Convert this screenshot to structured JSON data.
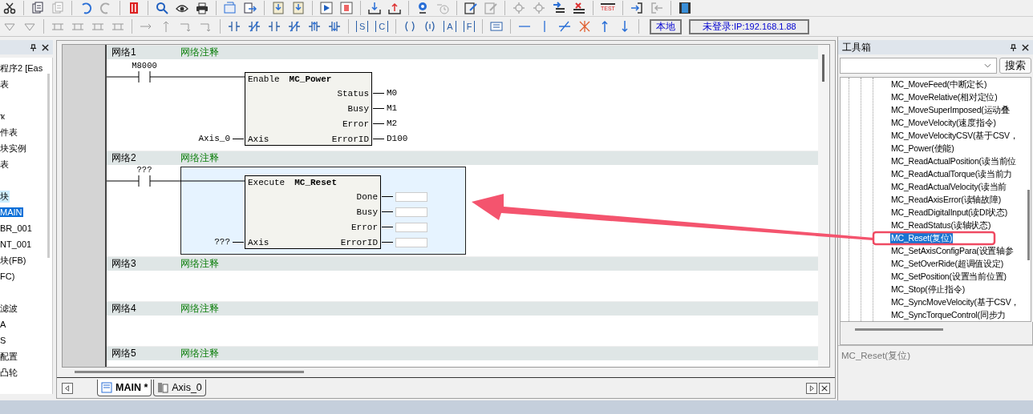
{
  "toolbar": {
    "test_label": "TEST",
    "instruction_letters": [
      "S",
      "C",
      "A",
      "F"
    ],
    "mode_button": "本地",
    "login_status": {
      "label": "未登录",
      "detail": ":IP:192.168.1.88"
    }
  },
  "project_panel": {
    "items": [
      {
        "label": "程序2 [Eas",
        "selected": false,
        "highlighted": false
      },
      {
        "label": "表",
        "selected": false,
        "highlighted": false,
        "gap_after": true
      },
      {
        "label": "ҡ",
        "selected": false,
        "highlighted": false
      },
      {
        "label": "件表",
        "selected": false,
        "highlighted": false
      },
      {
        "label": "块实例",
        "selected": false,
        "highlighted": false
      },
      {
        "label": "表",
        "selected": false,
        "highlighted": false,
        "gap_after": true
      },
      {
        "label": "块",
        "selected": false,
        "highlighted": true
      },
      {
        "label": "MAIN",
        "selected": true
      },
      {
        "label": "BR_001",
        "selected": false,
        "highlighted": false
      },
      {
        "label": "NT_001",
        "selected": false,
        "highlighted": false
      },
      {
        "label": "块(FB)",
        "selected": false,
        "highlighted": false
      },
      {
        "label": "FC)",
        "selected": false,
        "highlighted": false,
        "gap_after": true
      },
      {
        "label": "滤波",
        "selected": false,
        "highlighted": false
      },
      {
        "label": "A",
        "selected": false,
        "highlighted": false
      },
      {
        "label": "S",
        "selected": false,
        "highlighted": false
      },
      {
        "label": "配置",
        "selected": false,
        "highlighted": false
      },
      {
        "label": "凸轮",
        "selected": false,
        "highlighted": false
      }
    ]
  },
  "editor": {
    "networks": [
      {
        "label": "网络1",
        "comment": "网络注释",
        "selected": false,
        "contact": "M8000",
        "block": {
          "name": "MC_Power",
          "enable_pin": "Enable",
          "inputs": [
            {
              "pin": "Axis",
              "value": "Axis_0"
            }
          ],
          "outputs": [
            {
              "pin": "Status",
              "value": "M0"
            },
            {
              "pin": "Busy",
              "value": "M1"
            },
            {
              "pin": "Error",
              "value": "M2"
            },
            {
              "pin": "ErrorID",
              "value": "D100"
            }
          ]
        }
      },
      {
        "label": "网络2",
        "comment": "网络注释",
        "selected": true,
        "contact": "???",
        "block": {
          "name": "MC_Reset",
          "enable_pin": "Execute",
          "inputs": [
            {
              "pin": "Axis",
              "value": "???"
            }
          ],
          "outputs": [
            {
              "pin": "Done"
            },
            {
              "pin": "Busy"
            },
            {
              "pin": "Error"
            },
            {
              "pin": "ErrorID"
            }
          ]
        }
      },
      {
        "label": "网络3",
        "comment": "网络注释",
        "selected": false
      },
      {
        "label": "网络4",
        "comment": "网络注释",
        "selected": false
      },
      {
        "label": "网络5",
        "comment": "网络注释",
        "selected": false
      }
    ],
    "tabs": [
      {
        "label": "MAIN *",
        "kind": "program",
        "selected": true
      },
      {
        "label": "Axis_0",
        "kind": "axis",
        "selected": false
      }
    ]
  },
  "toolbox": {
    "title": "工具箱",
    "search_button": "搜索",
    "items": [
      {
        "label": "MC_MoveFeed(中断定长)",
        "selected": false
      },
      {
        "label": "MC_MoveRelative(相对定位)",
        "selected": false
      },
      {
        "label": "MC_MoveSuperImposed(运动叠",
        "selected": false
      },
      {
        "label": "MC_MoveVelocity(速度指令)",
        "selected": false
      },
      {
        "label": "MC_MoveVelocityCSV(基于CSV，",
        "selected": false
      },
      {
        "label": "MC_Power(使能)",
        "selected": false
      },
      {
        "label": "MC_ReadActualPosition(读当前位",
        "selected": false
      },
      {
        "label": "MC_ReadActualTorque(读当前力",
        "selected": false
      },
      {
        "label": "MC_ReadActualVelocity(读当前",
        "selected": false
      },
      {
        "label": "MC_ReadAxisError(读轴故障)",
        "selected": false
      },
      {
        "label": "MC_ReadDigitalInput(读DI状态)",
        "selected": false
      },
      {
        "label": "MC_ReadStatus(读轴状态)",
        "selected": false
      },
      {
        "label": "MC_Reset(复位)",
        "selected": true
      },
      {
        "label": "MC_SetAxisConfigPara(设置轴参",
        "selected": false
      },
      {
        "label": "MC_SetOverRide(超调值设定)",
        "selected": false
      },
      {
        "label": "MC_SetPosition(设置当前位置)",
        "selected": false
      },
      {
        "label": "MC_Stop(停止指令)",
        "selected": false
      },
      {
        "label": "MC_SyncMoveVelocity(基于CSV，",
        "selected": false
      },
      {
        "label": "MC_SyncTorqueControl(同步力",
        "selected": false
      }
    ],
    "description": "MC_Reset(复位)"
  }
}
